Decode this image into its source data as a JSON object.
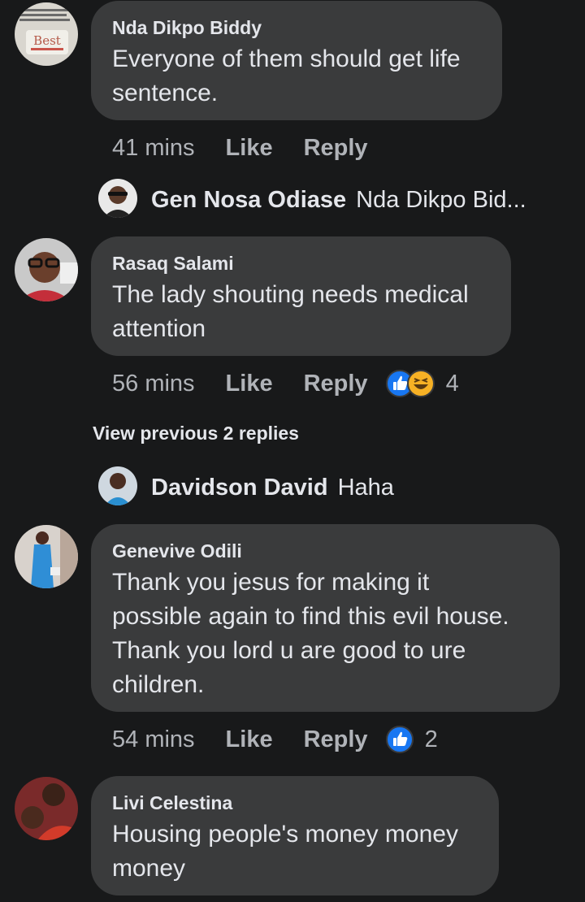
{
  "comments": [
    {
      "author": "Nda Dikpo Biddy",
      "lines": [
        "Everyone of them should get life",
        "sentence."
      ],
      "time": "41 mins",
      "like": "Like",
      "reply": "Reply"
    },
    {
      "author": "Rasaq Salami",
      "lines": [
        "The lady shouting needs medical",
        "attention"
      ],
      "time": "56 mins",
      "like": "Like",
      "reply": "Reply",
      "reaction_count": "4",
      "reaction_icons": [
        "like-reaction-icon",
        "haha-reaction-icon"
      ]
    },
    {
      "author": "Genevive Odili",
      "lines": [
        "Thank you jesus for making it",
        "possible again to find this evil house.",
        "Thank you lord u are good to ure",
        "children."
      ],
      "time": "54 mins",
      "like": "Like",
      "reply": "Reply",
      "reaction_count": "2",
      "reaction_icons": [
        "like-reaction-icon"
      ]
    },
    {
      "author": "Livi Celestina",
      "lines": [
        "Housing people's money money money",
        "money"
      ],
      "lines_display": [
        "Housing people's money money",
        "money"
      ]
    }
  ],
  "replies": [
    {
      "author": "Gen Nosa Odiase",
      "text": "Nda Dikpo Bid..."
    },
    {
      "author": "Davidson David",
      "text": "Haha"
    }
  ],
  "view_previous": "View previous 2 replies",
  "avatar_image_text": "Best",
  "colors": {
    "background": "#18191a",
    "bubble": "#3a3b3c",
    "text": "#e4e6eb",
    "secondary_text": "#b0b3b8",
    "like_blue": "#1877f2",
    "haha_yellow": "#f7b125"
  }
}
